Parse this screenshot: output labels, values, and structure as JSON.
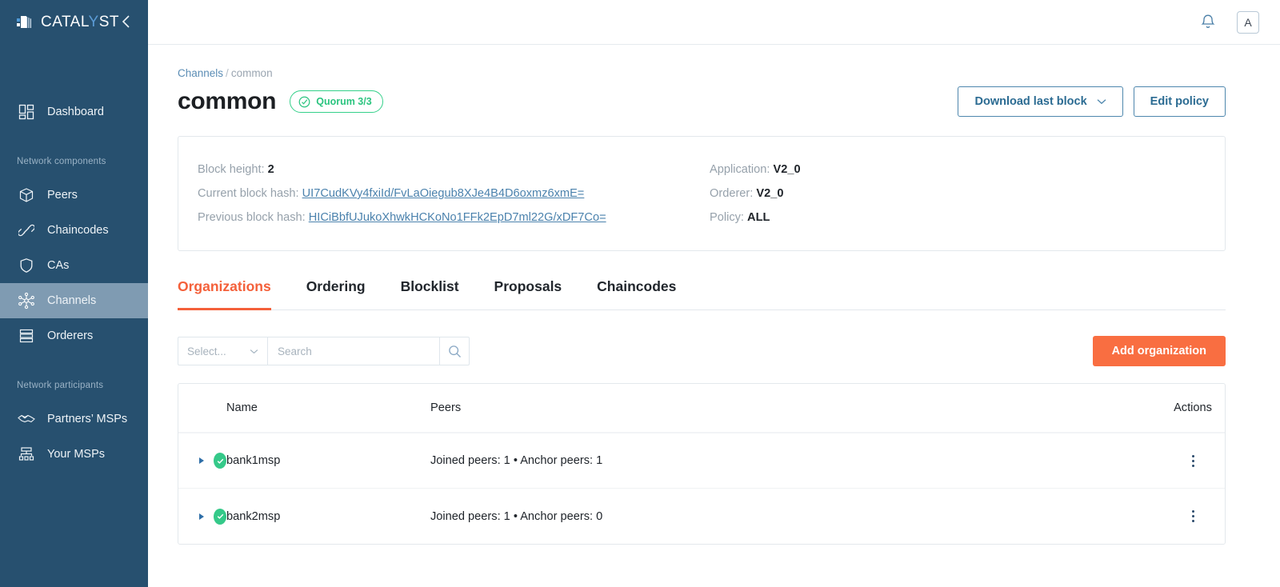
{
  "sidebar": {
    "brand": {
      "name_primary": "CATAL",
      "name_accent": "Y",
      "name_tail": "ST",
      "logo_icon": "catalyst-cube-logo"
    },
    "collapse_icon": "chevron-left-icon",
    "top_items": [
      {
        "label": "Dashboard",
        "icon": "dashboard-grid-icon",
        "active": false
      }
    ],
    "sections": [
      {
        "label": "Network components",
        "items": [
          {
            "label": "Peers",
            "icon": "cube-icon",
            "active": false
          },
          {
            "label": "Chaincodes",
            "icon": "link-chain-icon",
            "active": false
          },
          {
            "label": "CAs",
            "icon": "shield-icon",
            "active": false
          },
          {
            "label": "Channels",
            "icon": "network-nodes-icon",
            "active": true
          },
          {
            "label": "Orderers",
            "icon": "server-stack-icon",
            "active": false
          }
        ]
      },
      {
        "label": "Network participants",
        "items": [
          {
            "label": "Partners’ MSPs",
            "icon": "handshake-icon",
            "active": false
          },
          {
            "label": "Your MSPs",
            "icon": "org-tree-icon",
            "active": false
          }
        ]
      }
    ]
  },
  "topbar": {
    "bell_icon": "bell-icon",
    "avatar_label": "A"
  },
  "breadcrumb": {
    "root": "Channels",
    "separator": "/",
    "current": "common"
  },
  "header": {
    "title": "common",
    "badge": {
      "label": "Quorum 3/3",
      "icon": "check-circle-icon",
      "color": "#2bc47f"
    },
    "download_button": {
      "label": "Download last block",
      "caret_icon": "chevron-down-icon"
    },
    "edit_button": {
      "label": "Edit policy"
    }
  },
  "info_card": {
    "left": [
      {
        "label": "Block height:",
        "value": "2",
        "link": false
      },
      {
        "label": "Current block hash:",
        "value": "UI7CudKVy4fxiId/FvLaOiegub8XJe4B4D6oxmz6xmE=",
        "link": true
      },
      {
        "label": "Previous block hash:",
        "value": "HICiBbfUJukoXhwkHCKoNo1FFk2EpD7ml22G/xDF7Co=",
        "link": true
      }
    ],
    "right": [
      {
        "label": "Application:",
        "value": "V2_0"
      },
      {
        "label": "Orderer:",
        "value": "V2_0"
      },
      {
        "label": "Policy:",
        "value": "ALL"
      }
    ]
  },
  "tabs": [
    {
      "label": "Organizations",
      "active": true
    },
    {
      "label": "Ordering",
      "active": false
    },
    {
      "label": "Blocklist",
      "active": false
    },
    {
      "label": "Proposals",
      "active": false
    },
    {
      "label": "Chaincodes",
      "active": false
    }
  ],
  "toolbar": {
    "select_placeholder": "Select...",
    "select_caret_icon": "chevron-down-icon",
    "search_placeholder": "Search",
    "search_value": "",
    "search_icon": "search-icon",
    "add_button_label": "Add organization",
    "accent_color": "#f96e41"
  },
  "table": {
    "columns": [
      "",
      "Name",
      "Peers",
      "Actions"
    ],
    "rows": [
      {
        "status": "ok",
        "expand_icon": "caret-right-icon",
        "name": "bank1msp",
        "peers": "Joined peers: 1 • Anchor peers: 1",
        "actions_icon": "kebab-menu-icon"
      },
      {
        "status": "ok",
        "expand_icon": "caret-right-icon",
        "name": "bank2msp",
        "peers": "Joined peers: 1 • Anchor peers: 0",
        "actions_icon": "kebab-menu-icon"
      }
    ]
  }
}
